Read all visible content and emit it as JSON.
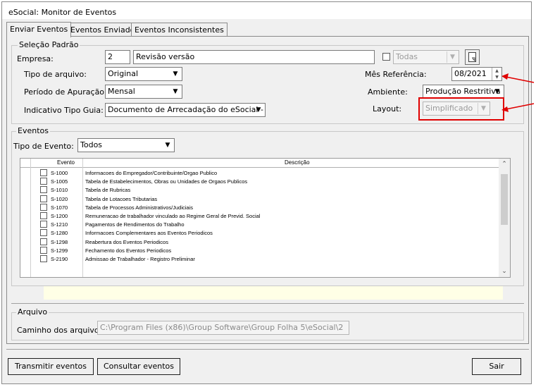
{
  "window": {
    "title": "eSocial: Monitor de Eventos"
  },
  "tabs": [
    "Enviar Eventos",
    "Eventos Enviados",
    "Eventos Inconsistentes"
  ],
  "selecao": {
    "group_title": "Seleção Padrão",
    "empresa_label": "Empresa:",
    "empresa_code": "2",
    "empresa_name": "Revisão versão",
    "todas_label": "Todas",
    "tipo_arquivo_label": "Tipo de arquivo:",
    "tipo_arquivo_value": "Original",
    "periodo_label": "Período de Apuração:",
    "periodo_value": "Mensal",
    "indicativo_label": "Indicativo Tipo Guia:",
    "indicativo_value": "Documento de Arrecadação do eSocial - DAE",
    "mes_ref_label": "Mês Referência:",
    "mes_ref_value": "08/2021",
    "ambiente_label": "Ambiente:",
    "ambiente_value": "Produção Restritiva",
    "layout_label": "Layout:",
    "layout_value": "Simplificado"
  },
  "eventos": {
    "group_title": "Eventos",
    "tipo_label": "Tipo de Evento:",
    "tipo_value": "Todos",
    "columns": [
      "Evento",
      "Descrição"
    ],
    "rows": [
      {
        "code": "S-1000",
        "desc": "Informacoes do Empregador/Contribuinte/Orgao Publico"
      },
      {
        "code": "S-1005",
        "desc": "Tabela de Estabelecimentos, Obras ou Unidades de Orgaos Publicos"
      },
      {
        "code": "S-1010",
        "desc": "Tabela de Rubricas"
      },
      {
        "code": "S-1020",
        "desc": "Tabela de Lotacoes Tributarias"
      },
      {
        "code": "S-1070",
        "desc": "Tabela de Processos Administrativos/Judiciais"
      },
      {
        "code": "S-1200",
        "desc": "Remuneracao de trabalhador vinculado ao Regime Geral de Previd. Social"
      },
      {
        "code": "S-1210",
        "desc": "Pagamentos de Rendimentos do Trabalho"
      },
      {
        "code": "S-1280",
        "desc": "Informacoes Complementares aos Eventos Periodicos"
      },
      {
        "code": "S-1298",
        "desc": "Reabertura dos Eventos Periodicos"
      },
      {
        "code": "S-1299",
        "desc": "Fechamento dos Eventos Periodicos"
      },
      {
        "code": "S-2190",
        "desc": "Admissao de Trabalhador - Registro Preliminar"
      }
    ]
  },
  "arquivo": {
    "group_title": "Arquivo",
    "caminho_label": "Caminho dos arquivos:",
    "caminho_value": "C:\\Program Files (x86)\\Group Software\\Group Folha 5\\eSocial\\2"
  },
  "buttons": {
    "transmitir": "Transmitir eventos",
    "consultar": "Consultar eventos",
    "sair": "Sair"
  },
  "colors": {
    "highlight": "#e00000",
    "hint_bg": "#ffffe6"
  }
}
